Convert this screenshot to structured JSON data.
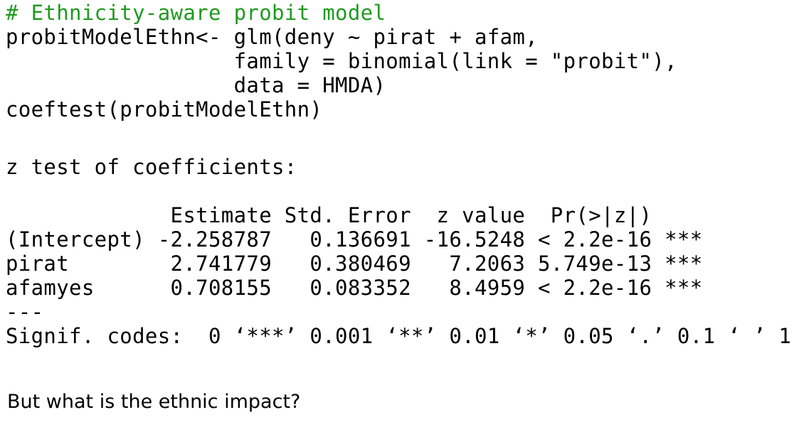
{
  "code": {
    "comment": "# Ethnicity-aware probit model",
    "line1": "probitModelEthn<- glm(deny ~ pirat + afam,",
    "line2": "                  family = binomial(link = \"probit\"),",
    "line3": "                  data = HMDA)",
    "line4": "coeftest(probitModelEthn)"
  },
  "output": {
    "title": "z test of coefficients:",
    "header": "             Estimate Std. Error  z value  Pr(>|z|)    ",
    "rows": [
      "(Intercept) -2.258787   0.136691 -16.5248 < 2.2e-16 ***",
      "pirat        2.741779   0.380469   7.2063 5.749e-13 ***",
      "afamyes      0.708155   0.083352   8.4959 < 2.2e-16 ***"
    ],
    "separator": "---",
    "signif_codes": "Signif. codes:  0 ‘***’ 0.001 ‘**’ 0.01 ‘*’ 0.05 ‘.’ 0.1 ‘ ’ 1"
  },
  "question": "But what is the ethnic impact?",
  "colors": {
    "comment": "#1f9a1f",
    "text": "#000000",
    "background": "#ffffff"
  }
}
